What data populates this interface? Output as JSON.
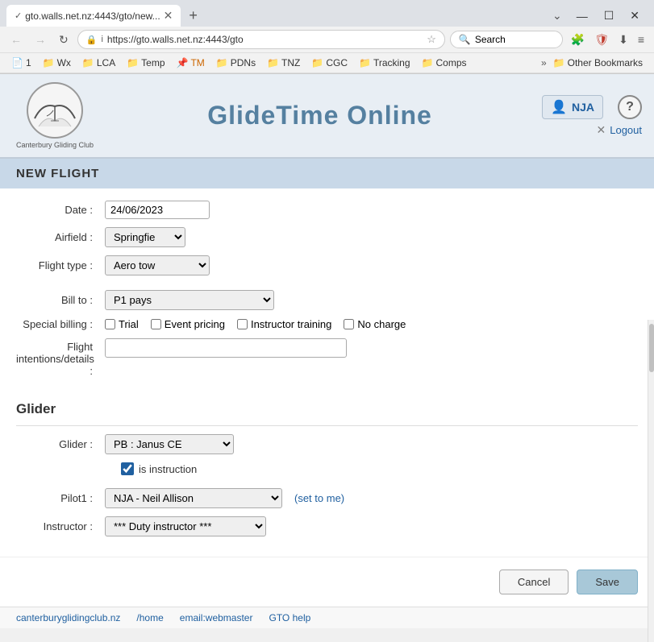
{
  "browser": {
    "tab_title": "gto.walls.net.nz:4443/gto/new...",
    "tab_favicon": "✓",
    "address": "https://gto.walls.net.nz:4443/gto",
    "search_placeholder": "Search",
    "win_min": "—",
    "win_restore": "☐",
    "win_close": "✕"
  },
  "bookmarks": [
    {
      "label": "1",
      "icon": "📄"
    },
    {
      "label": "Wx",
      "icon": "📁"
    },
    {
      "label": "LCA",
      "icon": "📁"
    },
    {
      "label": "Temp",
      "icon": "📁"
    },
    {
      "label": "TM",
      "icon": "📌"
    },
    {
      "label": "PDNs",
      "icon": "📁"
    },
    {
      "label": "TNZ",
      "icon": "📁"
    },
    {
      "label": "CGC",
      "icon": "📁"
    },
    {
      "label": "Tracking",
      "icon": "📁"
    },
    {
      "label": "Comps",
      "icon": "📁"
    }
  ],
  "other_bookmarks": "Other Bookmarks",
  "app": {
    "title": "GlideTime Online",
    "logo_club": "Canterbury Gliding Club",
    "user_name": "NJA",
    "logout_label": "Logout",
    "help_label": "?"
  },
  "form": {
    "page_title": "NEW FLIGHT",
    "date_label": "Date :",
    "date_value": "24/06/2023",
    "airfield_label": "Airfield :",
    "airfield_value": "Springfield",
    "flight_type_label": "Flight type :",
    "flight_type_value": "Aero tow",
    "bill_to_label": "Bill to :",
    "bill_to_value": "P1 pays",
    "special_billing_label": "Special billing :",
    "billing_options": [
      {
        "id": "trial",
        "label": "Trial",
        "checked": false
      },
      {
        "id": "event_pricing",
        "label": "Event pricing",
        "checked": false
      },
      {
        "id": "instructor_training",
        "label": "Instructor training",
        "checked": false
      },
      {
        "id": "no_charge",
        "label": "No charge",
        "checked": false
      }
    ],
    "flight_intentions_label": "Flight intentions/details :",
    "flight_intentions_value": "",
    "glider_section_title": "Glider",
    "glider_label": "Glider :",
    "glider_value": "PB : Janus CE",
    "is_instruction_label": "is instruction",
    "is_instruction_checked": true,
    "pilot1_label": "Pilot1 :",
    "pilot1_value": "NJA - Neil Allison",
    "set_to_me_label": "(set to me)",
    "instructor_label": "Instructor :",
    "instructor_value": "*** Duty instructor ***",
    "cancel_label": "Cancel",
    "save_label": "Save"
  },
  "footer": {
    "link1": "canterburyglidingclub.nz",
    "link2": "/home",
    "link3": "email:webmaster",
    "link4": "GTO help"
  }
}
